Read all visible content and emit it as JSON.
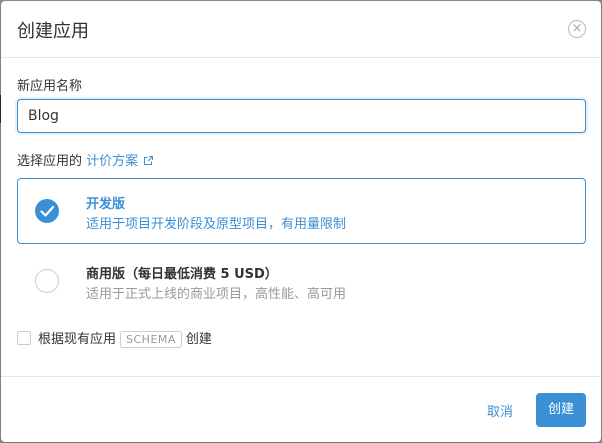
{
  "dialog": {
    "title": "创建应用",
    "close_icon": "×"
  },
  "form": {
    "name_label": "新应用名称",
    "name_value": "Blog",
    "plan_label_prefix": "选择应用的",
    "pricing_link": "计价方案"
  },
  "plans": [
    {
      "name": "开发版",
      "description": "适用于项目开发阶段及原型项目，有用量限制",
      "selected": true
    },
    {
      "name": "商用版（每日最低消费 5 USD）",
      "description": "适用于正式上线的商业项目，高性能、高可用",
      "selected": false
    }
  ],
  "schema_option": {
    "prefix": "根据现有应用",
    "badge": "SCHEMA",
    "suffix": "创建",
    "checked": false
  },
  "footer": {
    "cancel_label": "取消",
    "create_label": "创建"
  },
  "colors": {
    "accent": "#3b8fd5",
    "muted_text": "#999999"
  },
  "icons": [
    "close-icon",
    "external-link-icon",
    "check-icon"
  ]
}
